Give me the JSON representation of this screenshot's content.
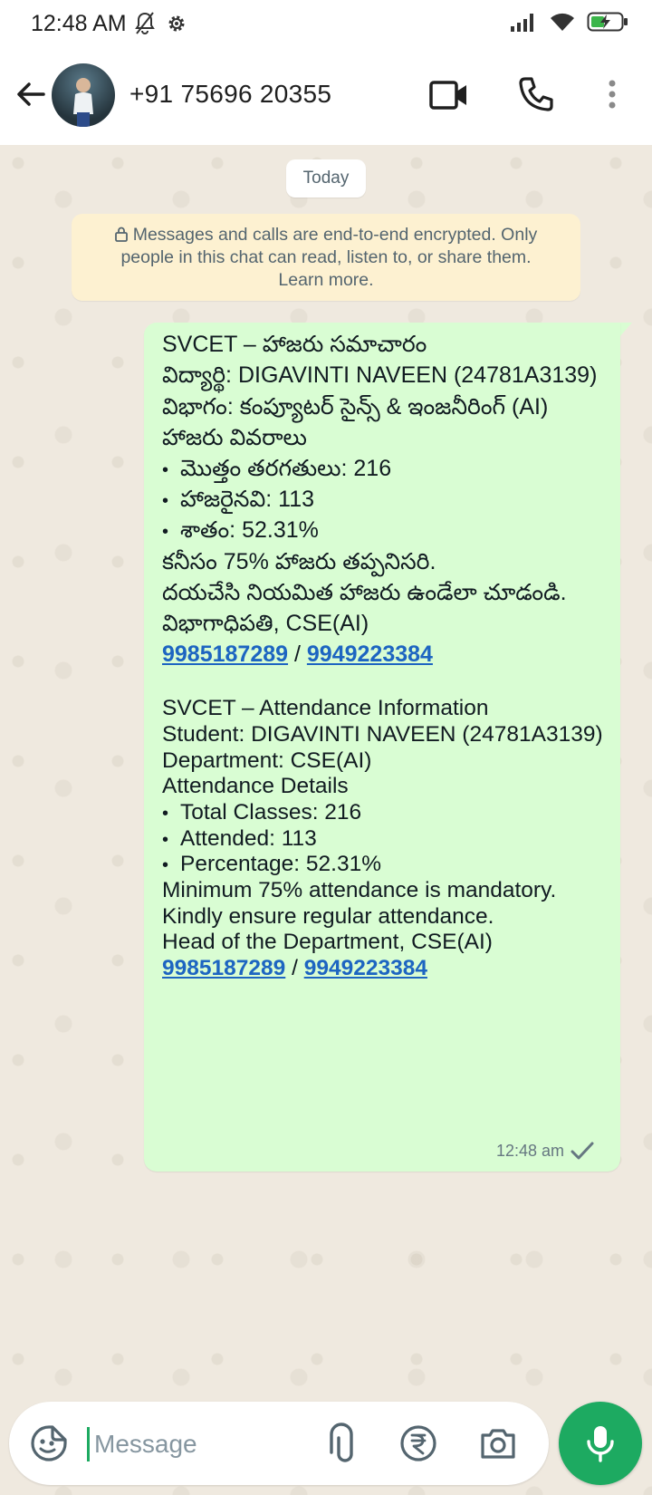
{
  "status_bar": {
    "time": "12:48 AM",
    "left_icons": [
      "mute-bell-icon",
      "gear-icon"
    ],
    "right_icons": [
      "signal-icon",
      "wifi-icon",
      "battery-charging-icon"
    ]
  },
  "header": {
    "contact_name": "+91 75696 20355",
    "icons": [
      "back-arrow-icon",
      "video-call-icon",
      "phone-icon",
      "more-vertical-icon"
    ]
  },
  "chat": {
    "date_chip": "Today",
    "encryption_notice": {
      "line1": "Messages and calls are end-to-end encrypted. Only",
      "line2": "people in this chat can read, listen to, or share them.",
      "line3": "Learn more."
    },
    "message": {
      "telugu": {
        "title": "SVCET – హాజరు సమాచారం",
        "student": "విద్యార్థి: DIGAVINTI NAVEEN (24781A3139)",
        "department": "విభాగం: కంప్యూటర్ సైన్స్ & ఇంజనీరింగ్ (AI)",
        "details_heading": "హాజరు వివరాలు",
        "total": "మొత్తం తరగతులు: 216",
        "attended": "హాజరైనవి: 113",
        "percentage": "శాతం: 52.31%",
        "minimum": "కనీసం 75% హాజరు తప్పనిసరి.",
        "request": "దయచేసి నియమిత హాజరు ఉండేలా చూడండి.",
        "signature": "విభాగాధిపతి, CSE(AI)",
        "phone1": "9985187289",
        "separator": " / ",
        "phone2": "9949223384"
      },
      "english": {
        "title": "SVCET – Attendance Information",
        "student": "Student: DIGAVINTI NAVEEN (24781A3139)",
        "department": "Department: CSE(AI)",
        "details_heading": "Attendance Details",
        "total": "Total Classes: 216",
        "attended": "Attended: 113",
        "percentage": "Percentage: 52.31%",
        "minimum": "Minimum 75% attendance is mandatory.",
        "request": "Kindly ensure regular attendance.",
        "signature": "Head of the Department, CSE(AI)",
        "phone1": "9985187289",
        "separator": " / ",
        "phone2": "9949223384"
      },
      "bullet": "•",
      "time": "12:48 am",
      "status_icon": "single-check-icon"
    }
  },
  "composer": {
    "placeholder": "Message",
    "icons": [
      "sticker-icon",
      "attach-icon",
      "rupee-payment-icon",
      "camera-icon",
      "mic-icon"
    ]
  },
  "colors": {
    "outgoing_bubble": "#d9fdd3",
    "link": "#1d65c1",
    "accent_green": "#1daa61",
    "encryption_bg": "#fdf1d1",
    "chat_bg": "#efe9df"
  }
}
